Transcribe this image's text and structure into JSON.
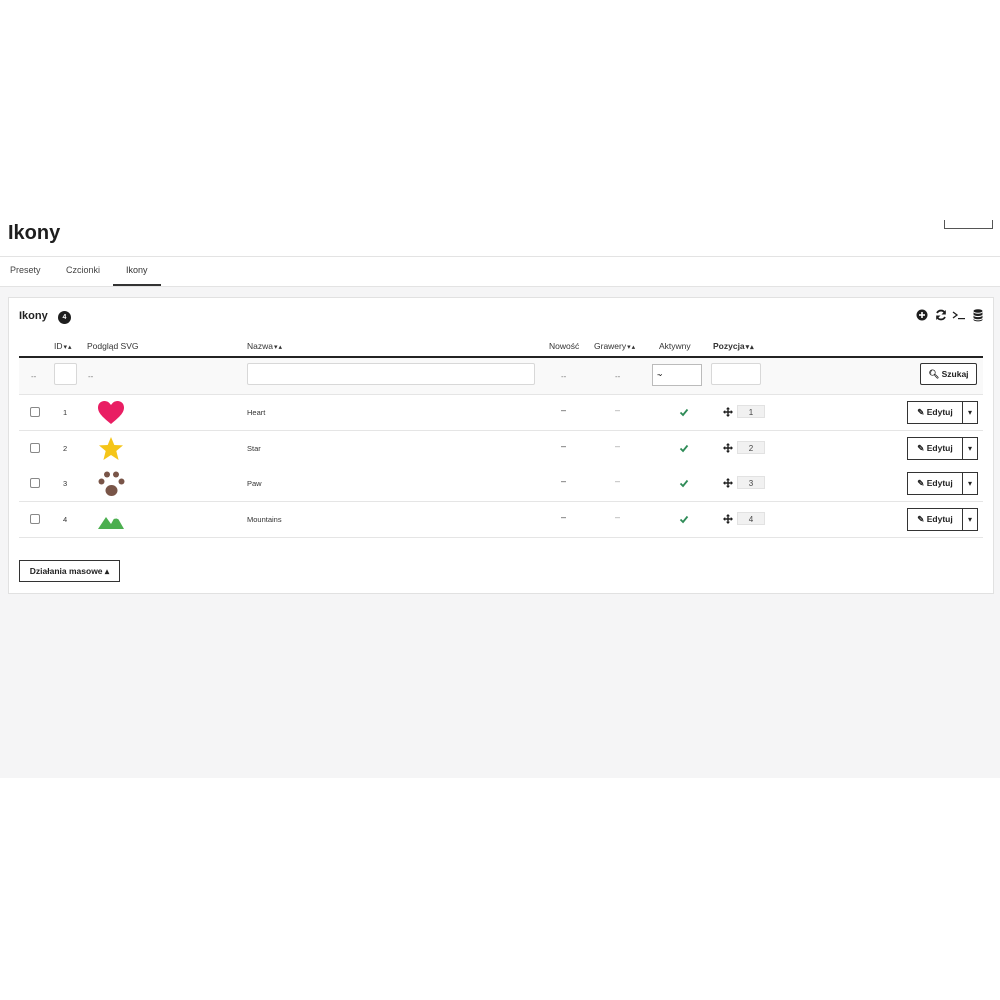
{
  "header": {
    "title": "Ikony"
  },
  "tabs": [
    {
      "label": "Presety"
    },
    {
      "label": "Czcionki"
    },
    {
      "label": "Ikony",
      "active": true
    }
  ],
  "panel": {
    "title": "Ikony",
    "count": "4",
    "toolbar": [
      "add-icon",
      "refresh-icon",
      "terminal-icon",
      "database-icon"
    ]
  },
  "table": {
    "columns": {
      "id": "ID",
      "preview": "Podgląd SVG",
      "name": "Nazwa",
      "nowosc": "Nowość",
      "grawery": "Grawery",
      "aktywny": "Aktywny",
      "pozycja": "Pozycja"
    },
    "sort_down": "▾",
    "sort_up": "▴",
    "filters": {
      "dash": "--",
      "select_value": "-",
      "search_label": "Szukaj"
    },
    "rows": [
      {
        "id": "1",
        "name": "Heart",
        "icon": "heart-icon",
        "icon_color": "#e91e63",
        "nowosc": "–",
        "grawery": "–",
        "aktywny": true,
        "position": "1"
      },
      {
        "id": "2",
        "name": "Star",
        "icon": "star-icon",
        "icon_color": "#f5c518",
        "nowosc": "–",
        "grawery": "–",
        "aktywny": true,
        "position": "2"
      },
      {
        "id": "3",
        "name": "Paw",
        "icon": "paw-icon",
        "icon_color": "#795548",
        "nowosc": "–",
        "grawery": "–",
        "aktywny": true,
        "position": "3"
      },
      {
        "id": "4",
        "name": "Mountains",
        "icon": "mountains-icon",
        "icon_color": "#4caf50",
        "nowosc": "–",
        "grawery": "–",
        "aktywny": true,
        "position": "4"
      }
    ],
    "edit_label": "Edytuj"
  },
  "bulk_actions": {
    "label": "Działania masowe"
  },
  "colors": {
    "active_check": "#2e8b57",
    "text_dark": "#1e1e1e",
    "background": "#f5f5f6"
  }
}
